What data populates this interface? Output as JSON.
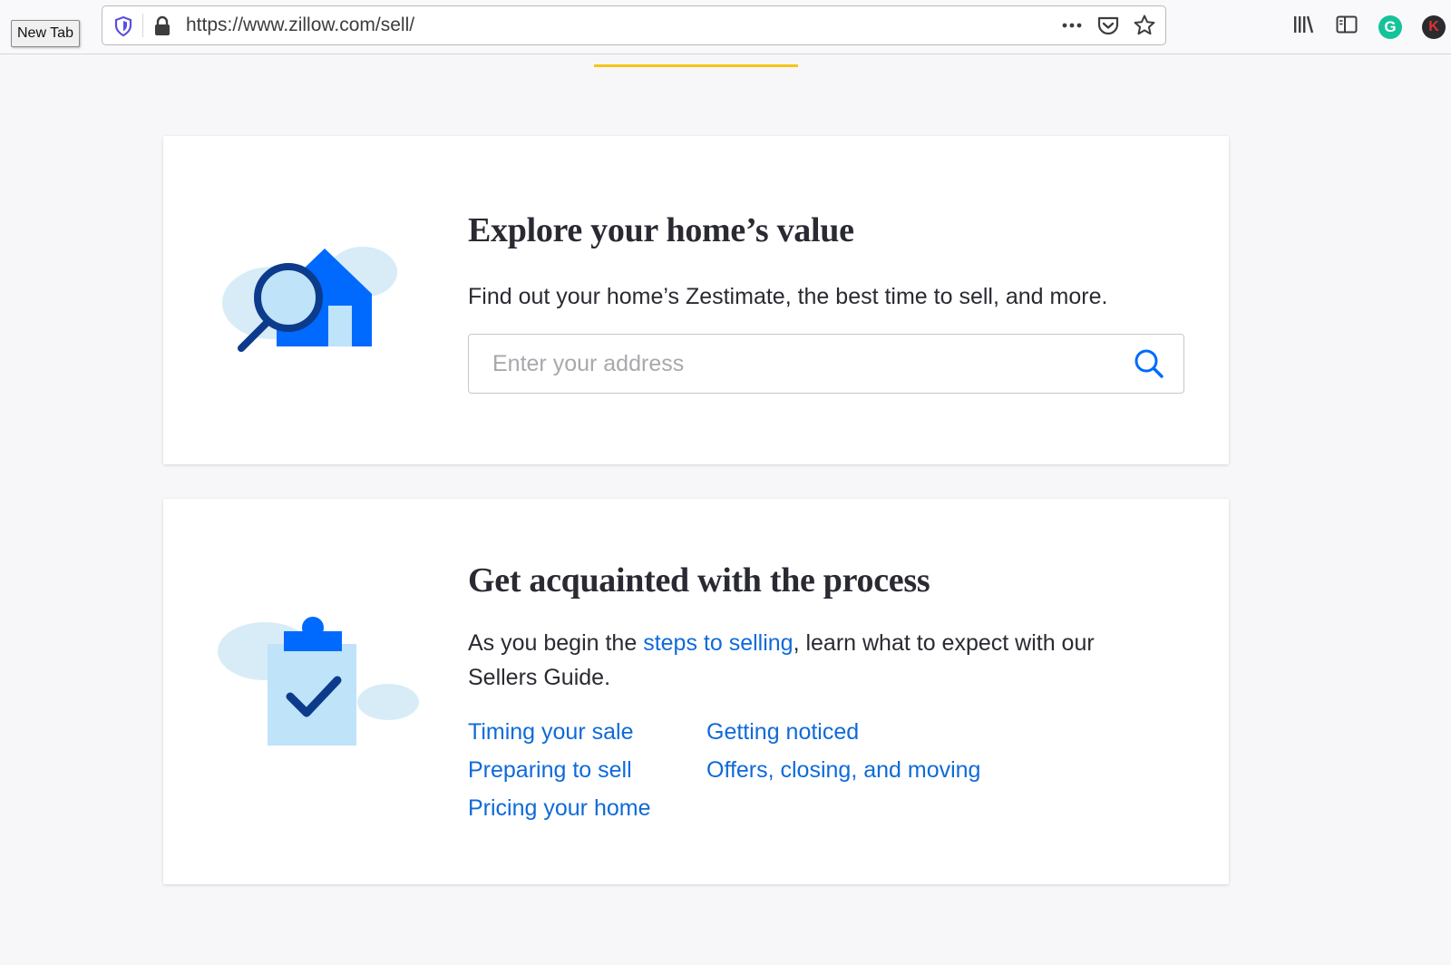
{
  "browser": {
    "tooltip": "New Tab",
    "url": "https://www.zillow.com/sell/",
    "grammarly_letter": "G",
    "profile_letter": "K"
  },
  "home_value": {
    "title": "Explore your home’s value",
    "description": "Find out your home’s Zestimate, the best time to sell, and more.",
    "search_placeholder": "Enter your address"
  },
  "process": {
    "title": "Get acquainted with the process",
    "description_before": "As you begin the ",
    "description_link": "steps to selling",
    "description_after": ", learn what to expect with our Sellers Guide.",
    "links_col1": [
      "Timing your sale",
      "Preparing to sell",
      "Pricing your home"
    ],
    "links_col2": [
      "Getting noticed",
      "Offers, closing, and moving"
    ]
  },
  "colors": {
    "link": "#0f6ad9",
    "brand_blue": "#006aff",
    "accent_yellow": "#f5c518"
  }
}
